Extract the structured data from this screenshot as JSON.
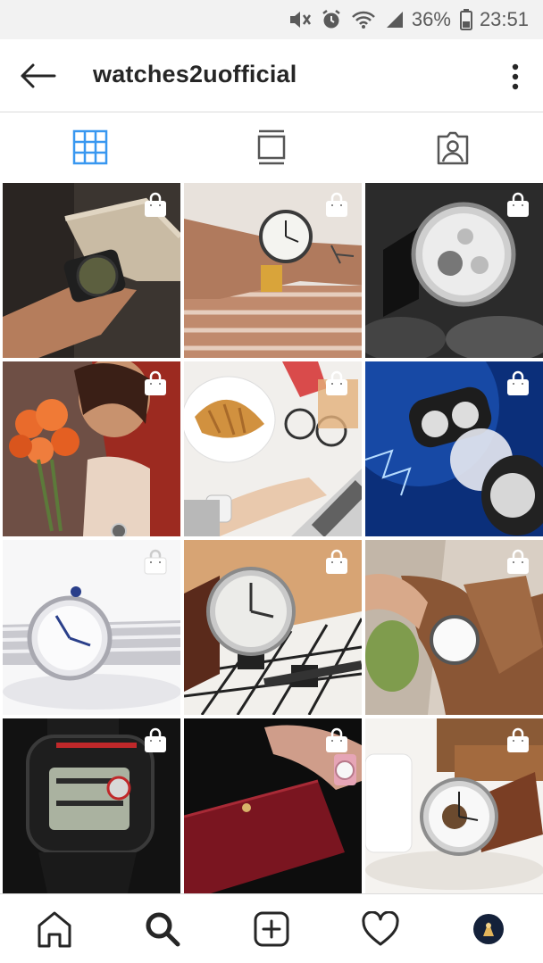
{
  "status_bar": {
    "battery": "36%",
    "time": "23:51",
    "icons": [
      "mute-icon",
      "alarm-icon",
      "wifi-icon",
      "signal-icon",
      "battery-icon"
    ]
  },
  "header": {
    "title": "watches2uofficial",
    "back_icon": "back-arrow-icon",
    "more_icon": "more-vertical-icon"
  },
  "view_tabs": [
    {
      "name": "grid-view",
      "icon": "grid-icon",
      "active": true
    },
    {
      "name": "feed-view",
      "icon": "feed-icon",
      "active": false
    },
    {
      "name": "tagged-view",
      "icon": "tagged-person-icon",
      "active": false
    }
  ],
  "posts": [
    {
      "subject": "knit sleeve wrist watch",
      "shoppable": true
    },
    {
      "subject": "white dial watch with tattoo",
      "shoppable": true
    },
    {
      "subject": "skeleton chronograph watch",
      "shoppable": true
    },
    {
      "subject": "woman with orange flowers",
      "shoppable": true
    },
    {
      "subject": "croissant and laptop desk",
      "shoppable": true
    },
    {
      "subject": "watch opening blue lightning",
      "shoppable": true
    },
    {
      "subject": "silver bracelet ladies watch",
      "shoppable": true
    },
    {
      "subject": "watch on crossword puzzle",
      "shoppable": true
    },
    {
      "subject": "watch with suede jacket",
      "shoppable": true
    },
    {
      "subject": "g-shock digital watch",
      "shoppable": true
    },
    {
      "subject": "red wallet and pink watch",
      "shoppable": true
    },
    {
      "subject": "skeleton watch with coffee",
      "shoppable": true
    }
  ],
  "colors": {
    "accent": "#3897f0",
    "text": "#262626",
    "divider": "#dbdbdb",
    "status_bg": "#f2f2f2"
  },
  "bottom_nav": [
    {
      "name": "home",
      "icon": "home-icon"
    },
    {
      "name": "search",
      "icon": "search-icon",
      "active": true
    },
    {
      "name": "add-post",
      "icon": "add-post-icon"
    },
    {
      "name": "activity",
      "icon": "heart-icon"
    },
    {
      "name": "profile",
      "icon": "avatar-icon"
    }
  ]
}
